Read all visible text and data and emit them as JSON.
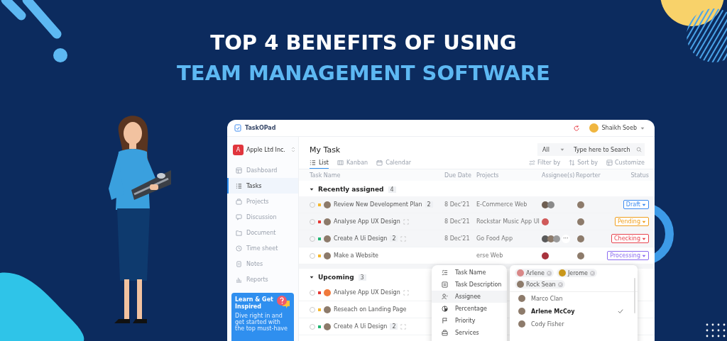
{
  "headline": {
    "line_1": "TOP 4 BENEFITS OF USING",
    "line_2": "TEAM MANAGEMENT SOFTWARE"
  },
  "app": {
    "logo": "TaskOPad",
    "user": "Shaikh Soeb",
    "workspace": {
      "initial": "A",
      "name": "Apple Ltd Inc."
    },
    "nav": [
      {
        "kind": "dashboard",
        "label": "Dashboard",
        "selected": false
      },
      {
        "kind": "tasks",
        "label": "Tasks",
        "selected": true
      },
      {
        "kind": "projects",
        "label": "Projects",
        "selected": false
      },
      {
        "kind": "discussion",
        "label": "Discussion",
        "selected": false
      },
      {
        "kind": "document",
        "label": "Document",
        "selected": false
      },
      {
        "kind": "timesheet",
        "label": "Time sheet",
        "selected": false
      },
      {
        "kind": "notes",
        "label": "Notes",
        "selected": false
      },
      {
        "kind": "reports",
        "label": "Reports",
        "selected": false
      }
    ],
    "promo": {
      "title": "Learn & Get Inspired",
      "text": "Dive right in and get started with the top must-have"
    },
    "page_title": "My Task",
    "filter": "All",
    "search_placeholder": "Type here to Search",
    "views": [
      {
        "kind": "list",
        "label": "List",
        "selected": true
      },
      {
        "kind": "kanban",
        "label": "Kanban",
        "selected": false
      },
      {
        "kind": "calendar",
        "label": "Calendar",
        "selected": false
      }
    ],
    "tools": [
      {
        "kind": "filter",
        "label": "Filter by"
      },
      {
        "kind": "sort",
        "label": "Sort by"
      },
      {
        "kind": "customize",
        "label": "Customize"
      }
    ],
    "columns": [
      "Task Name",
      "Due Date",
      "Projects",
      "Assignee(s)",
      "Reporter",
      "Status"
    ],
    "groups": [
      {
        "title": "Recently assigned",
        "count": "4",
        "expanded": true,
        "rows": [
          {
            "selected": true,
            "color": "#f5b82e",
            "owner": {
              "color": "#8d7b6b"
            },
            "name": "Review New Development Plan",
            "subtasks": "2",
            "linked": false,
            "due": "8 Dec'21",
            "project": "E-Commerce Web",
            "assignees": [
              {
                "color": "#6f5f52"
              },
              {
                "color": "#8a8a8a"
              }
            ],
            "reporter": {
              "color": "#8d7b6b"
            },
            "status": {
              "label": "Draft",
              "color": "#3d8bf0"
            }
          },
          {
            "selected": true,
            "color": "#e53935",
            "owner": {
              "color": "#8d7b6b"
            },
            "name": "Analyse App UX Design",
            "linked": true,
            "due": "8 Dec'21",
            "project": "Rockstar Music App UI",
            "assignees": [
              {
                "color": "#d05a5a"
              }
            ],
            "reporter": {
              "color": "#8d7b6b"
            },
            "status": {
              "label": "Pending",
              "color": "#f0a020"
            }
          },
          {
            "selected": true,
            "color": "#22b573",
            "owner": {
              "color": "#8d7b6b"
            },
            "name": "Create A Ui Design",
            "subtasks": "2",
            "linked": true,
            "due": "8 Dec'21",
            "project": "Go Food App",
            "assignees": [
              {
                "color": "#5a5a5a"
              },
              {
                "color": "#8d7b6b"
              },
              {
                "color": "#9a9a9a"
              }
            ],
            "more": "···",
            "reporter": {
              "color": "#8d7b6b"
            },
            "status": {
              "label": "Checking",
              "color": "#e8454f"
            }
          },
          {
            "selected": false,
            "color": "#f5b82e",
            "owner": {
              "color": "#8d7b6b"
            },
            "name": "Make a Website",
            "linked": false,
            "project": "erse Web",
            "assignees": [
              {
                "color": "#a8333d"
              }
            ],
            "reporter": {
              "color": "#8d7b6b"
            },
            "status": {
              "label": "Processing",
              "color": "#8b6cf0"
            }
          }
        ]
      },
      {
        "title": "Upcoming",
        "count": "3",
        "expanded": true,
        "rows": [
          {
            "selected": false,
            "color": "#e53935",
            "owner": {
              "color": "#f07a3c"
            },
            "name": "Analyse App UX Design",
            "linked": true
          },
          {
            "selected": false,
            "color": "#f5b82e",
            "owner": {
              "color": "#8d7b6b"
            },
            "name": "Reseach on Landing Page",
            "linked": false
          },
          {
            "selected": false,
            "color": "#22b573",
            "owner": {
              "color": "#8d7b6b"
            },
            "name": "Create A Ui Design",
            "subtasks": "2",
            "linked": true
          }
        ]
      }
    ],
    "column_menu": {
      "items": [
        {
          "kind": "task-name",
          "label": "Task Name",
          "selected": false
        },
        {
          "kind": "description",
          "label": "Task Description",
          "selected": false
        },
        {
          "kind": "assignee",
          "label": "Assignee",
          "selected": true
        },
        {
          "kind": "percentage",
          "label": "Percentage",
          "selected": false
        },
        {
          "kind": "priority",
          "label": "Priority",
          "selected": false
        },
        {
          "kind": "services",
          "label": "Services",
          "selected": false
        }
      ]
    },
    "assignee_picker": {
      "chips": [
        {
          "name": "Arlene",
          "color": "#d98888"
        },
        {
          "name": "Jerome",
          "color": "#c9971a"
        },
        {
          "name": "Rock Sean",
          "color": "#8d7b6b"
        }
      ],
      "options": [
        {
          "name": "Marco Clan",
          "selected": false
        },
        {
          "name": "Arlene McCoy",
          "selected": true
        },
        {
          "name": "Cody Fisher",
          "selected": false
        }
      ]
    }
  }
}
